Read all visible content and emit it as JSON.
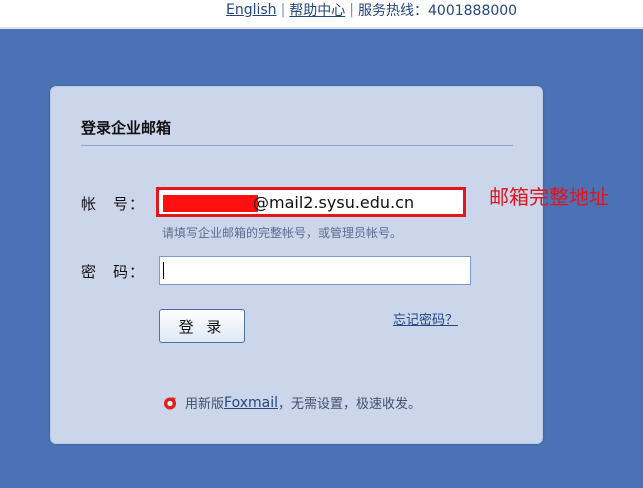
{
  "header": {
    "english_link": "English",
    "separator": "|",
    "help_link": "帮助中心",
    "hotline": "服务热线：4001888000"
  },
  "login": {
    "title": "登录企业邮箱",
    "account_label": "帐　号：",
    "account_value": "@mail2.sysu.edu.cn",
    "annotation": "邮箱完整地址",
    "account_hint": "请填写企业邮箱的完整帐号，或管理员帐号。",
    "password_label": "密　码：",
    "password_value": "",
    "login_button": "登 录",
    "forgot_link": "忘记密码？",
    "foxmail_prefix": "用新版",
    "foxmail_link": "Foxmail",
    "foxmail_suffix": "，无需设置，极速收发。"
  },
  "colors": {
    "background": "#4a72b4",
    "card": "#cbd6eb",
    "highlight_border": "#e4161c",
    "annotation": "#e1141b",
    "link": "#23477f"
  },
  "icons": {
    "foxmail": "foxmail-logo-icon"
  }
}
